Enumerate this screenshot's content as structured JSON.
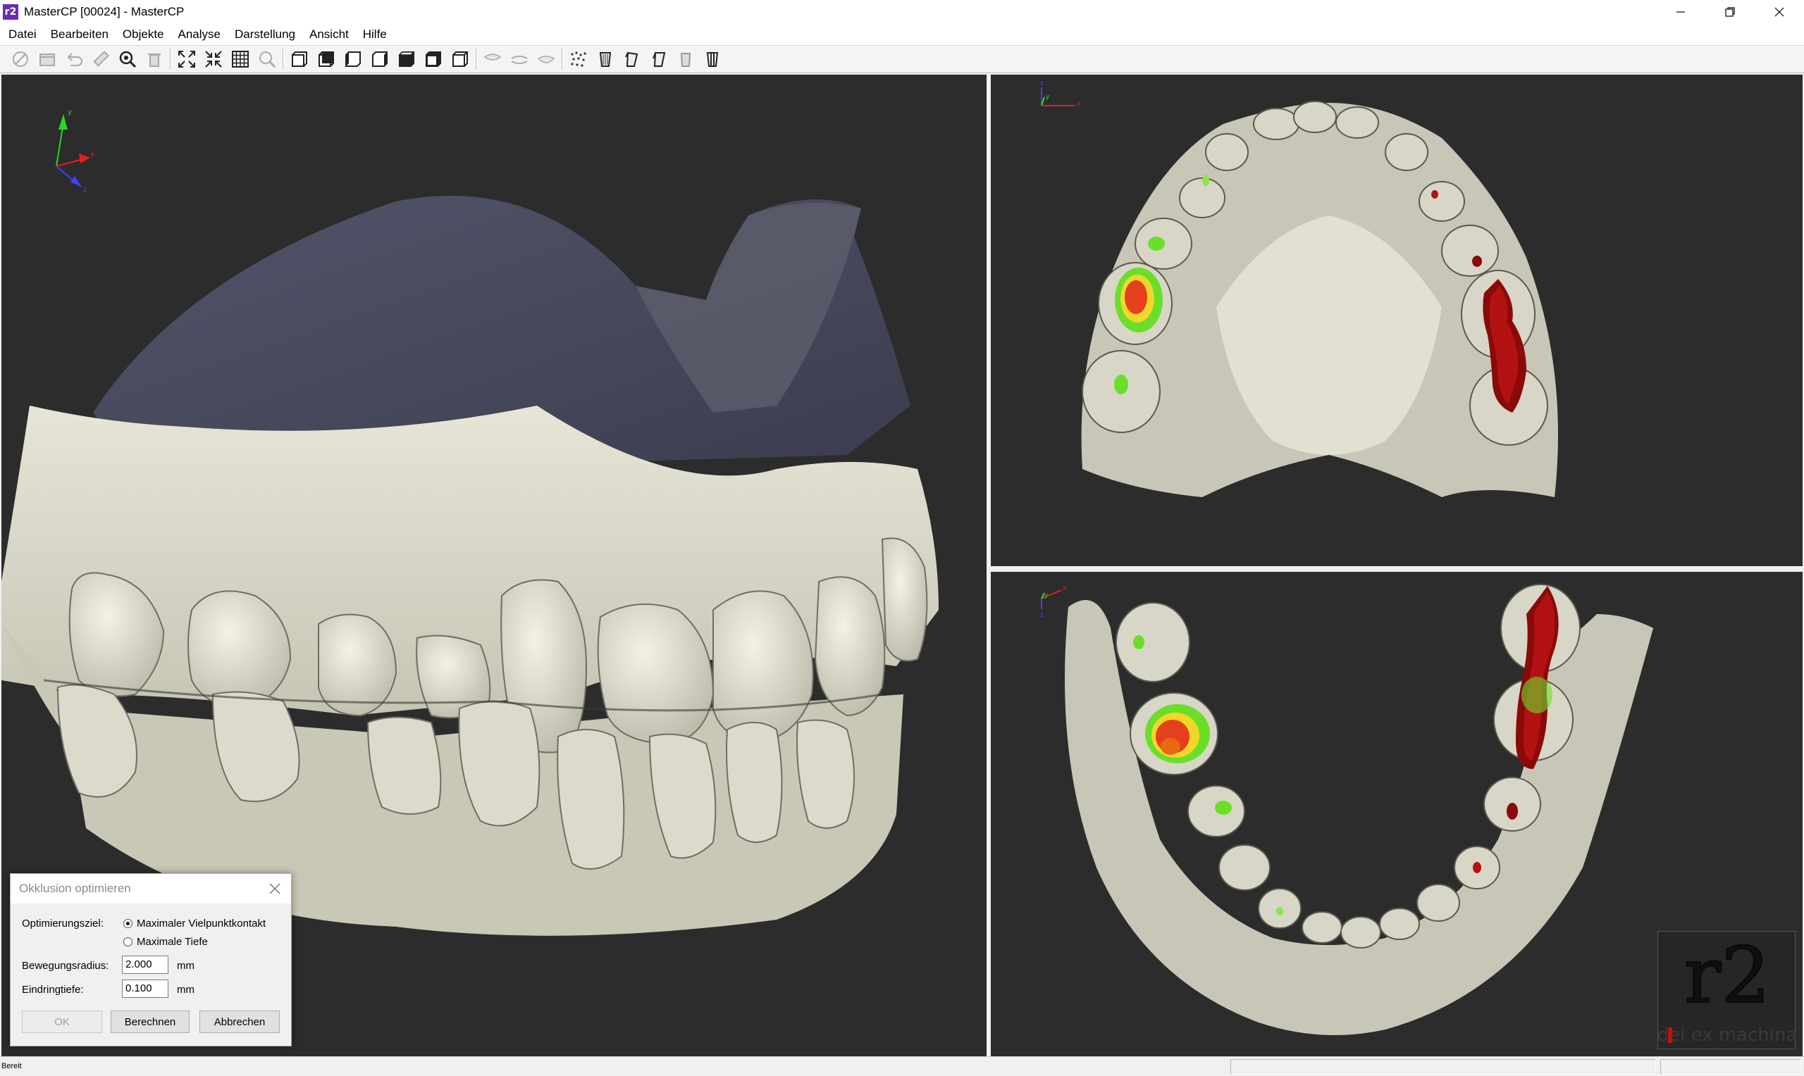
{
  "window": {
    "title": "MasterCP [00024] - MasterCP",
    "icon_text": "r2",
    "controls": [
      "minimize-icon",
      "restore-icon",
      "close-icon"
    ]
  },
  "menu": [
    "Datei",
    "Bearbeiten",
    "Objekte",
    "Analyse",
    "Darstellung",
    "Ansicht",
    "Hilfe"
  ],
  "toolbar": {
    "groups": [
      [
        "ruler-off-icon",
        "box-icon",
        "undo-icon",
        "measure-icon",
        "zoom-target-icon",
        "trash-icon"
      ],
      [
        "expand-icon",
        "collapse-icon",
        "grid-icon",
        "magnifier-icon"
      ],
      [
        "view-front-icon",
        "view-back-icon",
        "view-left-icon",
        "view-right-icon",
        "view-top-icon",
        "view-bottom-icon",
        "view-iso-icon"
      ],
      [
        "jaw-upper-icon",
        "jaw-open-icon",
        "jaw-lower-icon"
      ],
      [
        "points-icon",
        "tooth-cylinder-icon",
        "tooth-angle-icon",
        "tooth-angle2-icon",
        "tooth-cube-icon",
        "tooth-cut-icon"
      ]
    ]
  },
  "viewports": {
    "main_axes": [
      "y",
      "x",
      "z"
    ],
    "upper_axes": [
      "z",
      "y",
      "x"
    ],
    "lower_axes": [
      "x",
      "z",
      "y"
    ]
  },
  "dialog": {
    "title": "Okklusion optimieren",
    "goal_label": "Optimierungsziel:",
    "options": [
      {
        "label": "Maximaler Vielpunktkontakt",
        "selected": true
      },
      {
        "label": "Maximale Tiefe",
        "selected": false
      }
    ],
    "radius_label": "Bewegungsradius:",
    "radius_value": "2.000",
    "depth_label": "Eindringtiefe:",
    "depth_value": "0.100",
    "unit": "mm",
    "buttons": {
      "ok": "OK",
      "calculate": "Berechnen",
      "cancel": "Abbrechen"
    }
  },
  "logo": {
    "big": "r2",
    "small": "dei ex machina"
  },
  "status": {
    "text": "Bereit"
  }
}
